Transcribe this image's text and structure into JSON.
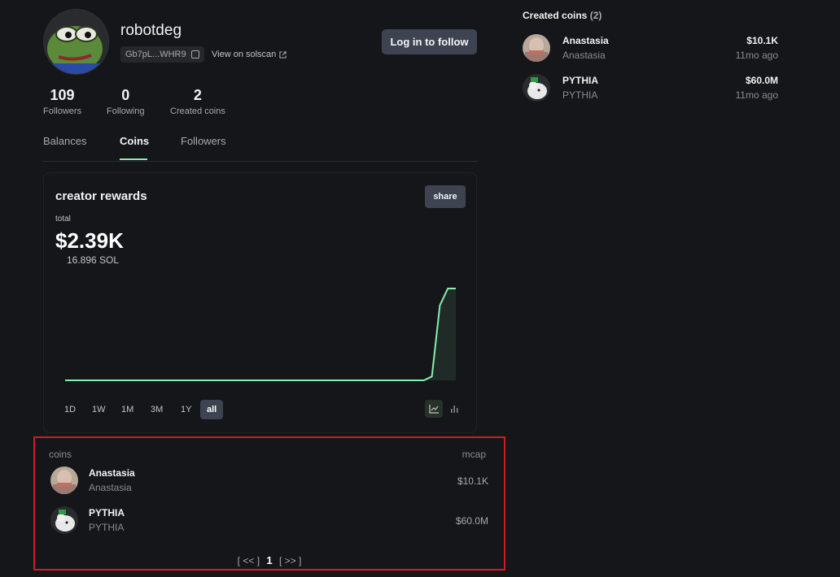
{
  "profile": {
    "username": "robotdeg",
    "address": "Gb7pL...WHR9",
    "solscan_label": "View on solscan",
    "follow_label": "Log in to follow",
    "avatar_icon": "pepe-frog-avatar",
    "stats": [
      {
        "value": "109",
        "label": "Followers"
      },
      {
        "value": "0",
        "label": "Following"
      },
      {
        "value": "2",
        "label": "Created coins"
      }
    ]
  },
  "tabs": [
    {
      "label": "Balances",
      "active": false
    },
    {
      "label": "Coins",
      "active": true
    },
    {
      "label": "Followers",
      "active": false
    }
  ],
  "rewards": {
    "title": "creator rewards",
    "share_label": "share",
    "total_label": "total",
    "total_value": "$2.39K",
    "sol_value": "16.896 SOL",
    "ranges": [
      "1D",
      "1W",
      "1M",
      "3M",
      "1Y",
      "all"
    ],
    "active_range": "all",
    "accent": "#86efac"
  },
  "chart_data": {
    "type": "line",
    "title": "creator rewards",
    "series": [
      {
        "values": [
          0,
          0,
          0,
          0,
          0,
          0,
          0,
          0,
          0,
          0,
          0,
          0,
          0,
          0,
          0,
          0,
          0,
          0,
          0,
          0,
          0,
          0,
          0,
          0,
          0,
          0,
          0,
          0,
          0,
          0,
          0,
          0,
          0,
          0,
          0,
          0,
          0,
          0,
          0,
          0,
          0,
          0,
          0,
          0,
          0,
          0,
          0.1,
          1.95,
          2.39,
          2.39
        ]
      }
    ],
    "ylim": [
      0,
      2.39
    ],
    "grid": false
  },
  "coins_table": {
    "col_coins": "coins",
    "col_mcap": "mcap",
    "rows": [
      {
        "name": "Anastasia",
        "symbol": "Anastasia",
        "mcap": "$10.1K",
        "icon": "anastasia-coin-icon"
      },
      {
        "name": "PYTHIA",
        "symbol": "PYTHIA",
        "mcap": "$60.0M",
        "icon": "pythia-coin-icon"
      }
    ],
    "pager_prev": "[ << ]",
    "pager_page": "1",
    "pager_next": "[ >> ]"
  },
  "created_coins": {
    "title": "Created coins",
    "count": "(2)",
    "rows": [
      {
        "name": "Anastasia",
        "symbol": "Anastasia",
        "mcap": "$10.1K",
        "time": "11mo ago"
      },
      {
        "name": "PYTHIA",
        "symbol": "PYTHIA",
        "mcap": "$60.0M",
        "time": "11mo ago"
      }
    ]
  }
}
